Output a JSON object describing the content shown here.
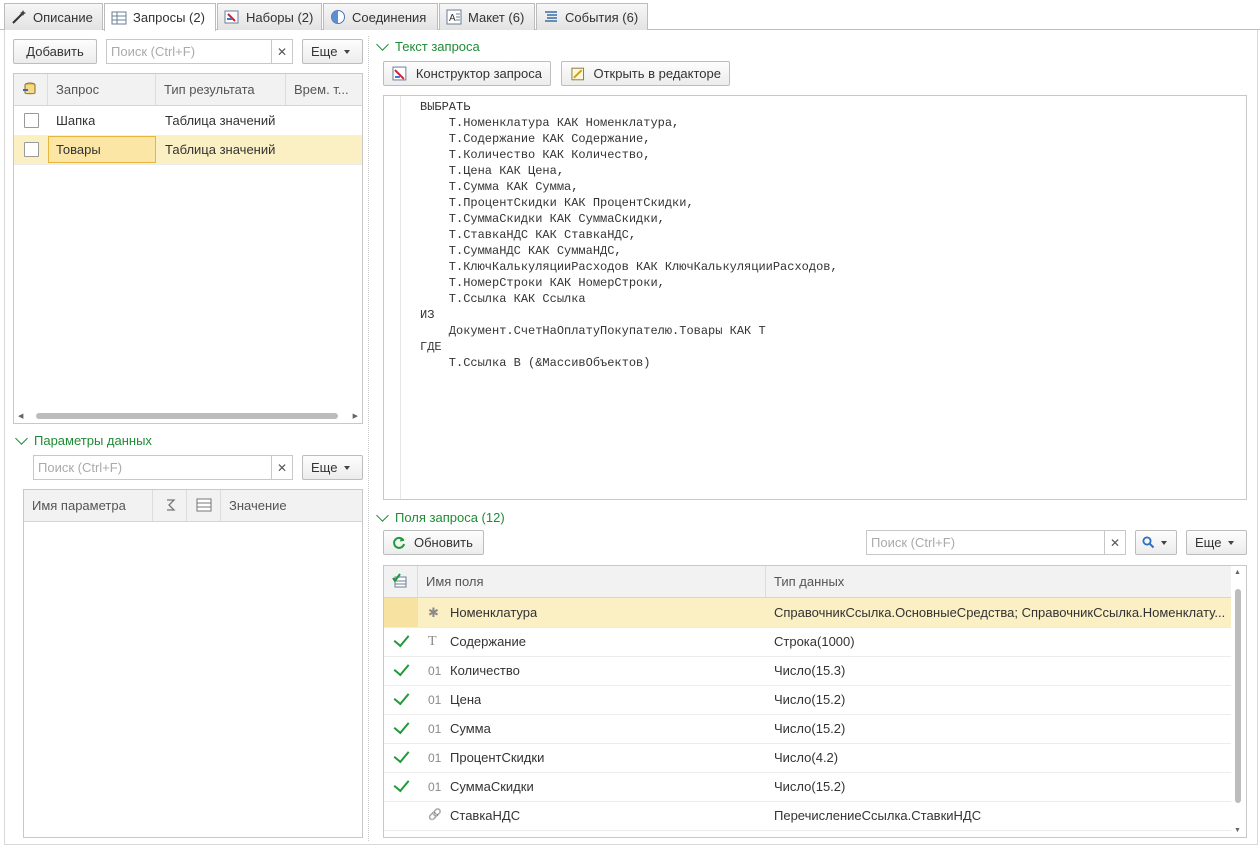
{
  "tabs": [
    {
      "label": "Описание"
    },
    {
      "label": "Запросы (2)"
    },
    {
      "label": "Наборы (2)"
    },
    {
      "label": "Соединения"
    },
    {
      "label": "Макет (6)"
    },
    {
      "label": "События (6)"
    }
  ],
  "queries": {
    "add_label": "Добавить",
    "search_placeholder": "Поиск (Ctrl+F)",
    "more_label": "Еще",
    "columns": [
      "Запрос",
      "Тип результата",
      "Врем. т..."
    ],
    "rows": [
      {
        "name": "Шапка",
        "type": "Таблица значений"
      },
      {
        "name": "Товары",
        "type": "Таблица значений"
      }
    ]
  },
  "params": {
    "title": "Параметры данных",
    "search_placeholder": "Поиск (Ctrl+F)",
    "more_label": "Еще",
    "columns": [
      "Имя параметра",
      "Значение"
    ]
  },
  "query_text": {
    "title": "Текст запроса",
    "constructor_label": "Конструктор запроса",
    "open_editor_label": "Открыть в редакторе",
    "code": "ВЫБРАТЬ\n    Т.Номенклатура КАК Номенклатура,\n    Т.Содержание КАК Содержание,\n    Т.Количество КАК Количество,\n    Т.Цена КАК Цена,\n    Т.Сумма КАК Сумма,\n    Т.ПроцентСкидки КАК ПроцентСкидки,\n    Т.СуммаСкидки КАК СуммаСкидки,\n    Т.СтавкаНДС КАК СтавкаНДС,\n    Т.СуммаНДС КАК СуммаНДС,\n    Т.КлючКалькуляцииРасходов КАК КлючКалькуляцииРасходов,\n    Т.НомерСтроки КАК НомерСтроки,\n    Т.Ссылка КАК Ссылка\nИЗ\n    Документ.СчетНаОплатуПокупателю.Товары КАК Т\nГДЕ\n    Т.Ссылка В (&МассивОбъектов)"
  },
  "fields": {
    "title": "Поля запроса (12)",
    "refresh_label": "Обновить",
    "search_placeholder": "Поиск (Ctrl+F)",
    "more_label": "Еще",
    "columns": [
      "Имя поля",
      "Тип данных"
    ],
    "rows": [
      {
        "icon": "*",
        "name": "Номенклатура",
        "type": "СправочникСсылка.ОсновныеСредства; СправочникСсылка.Номенклату...",
        "checked": false
      },
      {
        "icon": "T",
        "name": "Содержание",
        "type": "Строка(1000)",
        "checked": true
      },
      {
        "icon": "01",
        "name": "Количество",
        "type": "Число(15.3)",
        "checked": true
      },
      {
        "icon": "01",
        "name": "Цена",
        "type": "Число(15.2)",
        "checked": true
      },
      {
        "icon": "01",
        "name": "Сумма",
        "type": "Число(15.2)",
        "checked": true
      },
      {
        "icon": "01",
        "name": "ПроцентСкидки",
        "type": "Число(4.2)",
        "checked": true
      },
      {
        "icon": "01",
        "name": "СуммаСкидки",
        "type": "Число(15.2)",
        "checked": true
      },
      {
        "icon": "link",
        "name": "СтавкаНДС",
        "type": "ПеречислениеСсылка.СтавкиНДС",
        "checked": false
      }
    ]
  },
  "colors": {
    "accent": "#1e8c35",
    "selection": "#fbefc4"
  }
}
